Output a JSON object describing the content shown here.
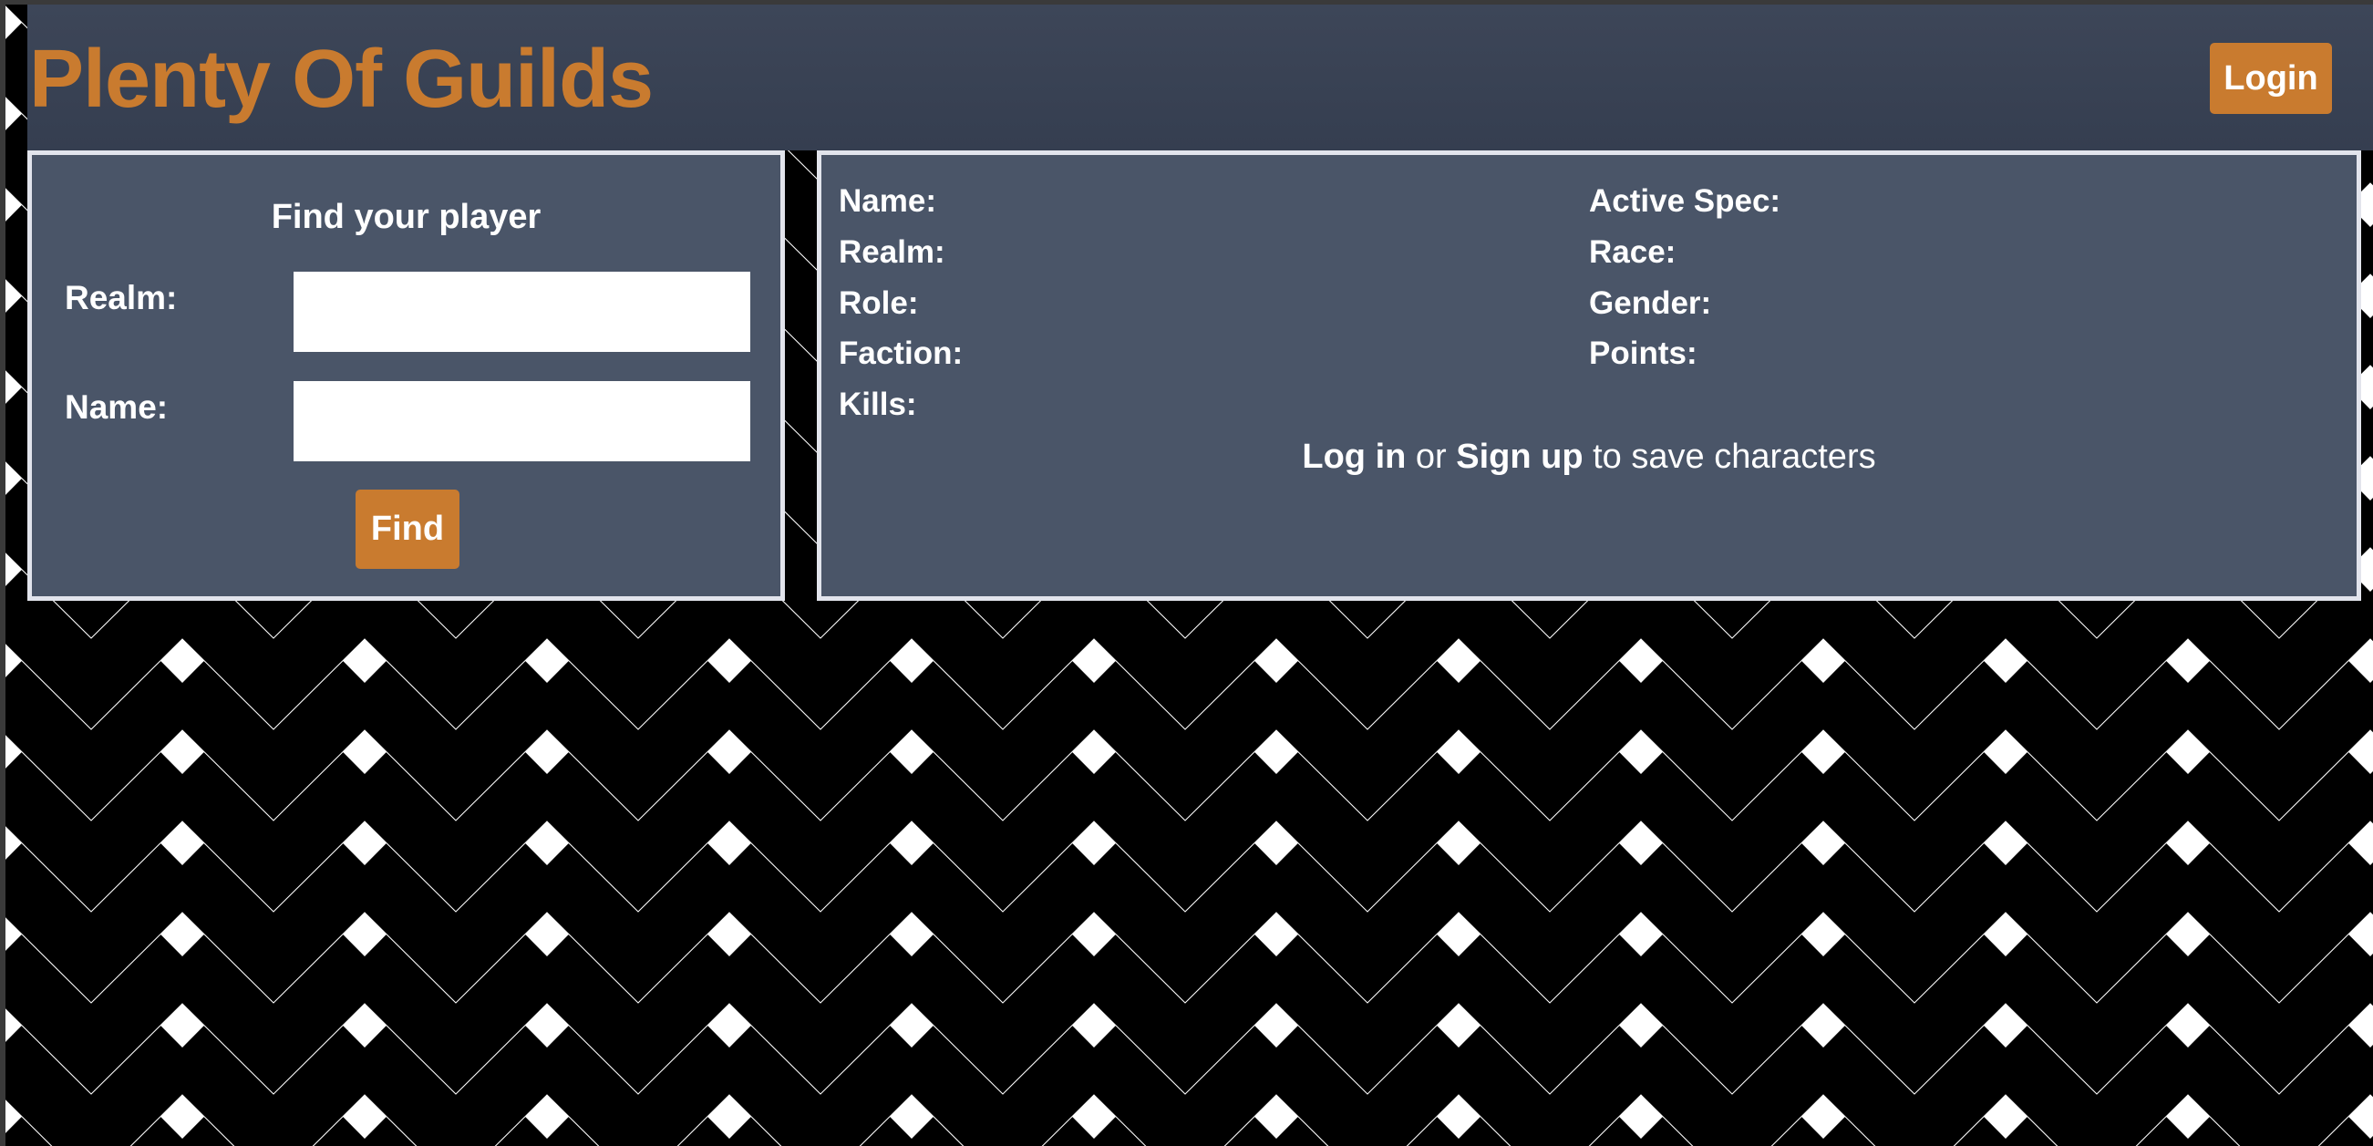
{
  "header": {
    "title": "Plenty Of Guilds",
    "login_label": "Login"
  },
  "find_panel": {
    "title": "Find your player",
    "realm_label": "Realm:",
    "realm_value": "",
    "name_label": "Name:",
    "name_value": "",
    "find_label": "Find"
  },
  "info_panel": {
    "left_fields": [
      "Name:",
      "Realm:",
      "Role:",
      "Faction:",
      "Kills:"
    ],
    "right_fields": [
      "Active Spec:",
      "Race:",
      "Gender:",
      "Points:"
    ],
    "save_prompt": {
      "login_link": "Log in",
      "or_text": " or ",
      "signup_link": "Sign up",
      "suffix": " to save characters"
    }
  },
  "colors": {
    "accent": "#c97b2f",
    "header_bg": "#3a4356",
    "panel_bg": "#4a5568",
    "panel_border": "#e2e4ec",
    "pattern_dark": "#000000",
    "pattern_light": "#ffffff"
  }
}
